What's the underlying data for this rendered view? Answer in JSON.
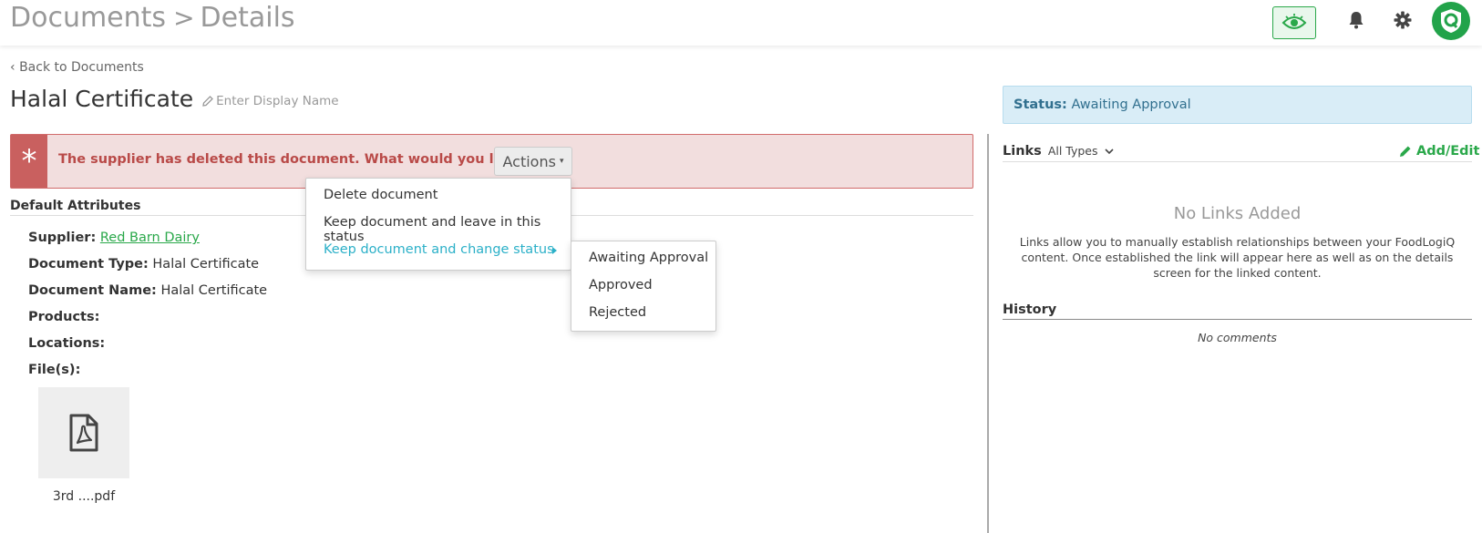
{
  "header": {
    "breadcrumb_root": "Documents",
    "breadcrumb_sep": ">",
    "breadcrumb_current": "Details",
    "icons": [
      "eye-icon",
      "bell-icon",
      "gear-icon",
      "foodlogiq-logo"
    ],
    "accent": "#2aa84a"
  },
  "back_link": "Back to Documents",
  "document": {
    "title": "Halal Certificate",
    "display_name_placeholder": "Enter Display Name"
  },
  "alert": {
    "symbol": "*",
    "message": "The supplier has deleted this document. What would you like to do?",
    "actions_label": "Actions"
  },
  "actions_menu": {
    "items": [
      {
        "label": "Delete document"
      },
      {
        "label": "Keep document and leave in this status"
      },
      {
        "label": "Keep document and change status"
      }
    ],
    "status_submenu": [
      {
        "label": "Awaiting Approval"
      },
      {
        "label": "Approved"
      },
      {
        "label": "Rejected"
      }
    ]
  },
  "attributes": {
    "section_title": "Default Attributes",
    "supplier_label": "Supplier:",
    "supplier_value": "Red Barn Dairy",
    "doc_type_label": "Document Type:",
    "doc_type_value": "Halal Certificate",
    "doc_name_label": "Document Name:",
    "doc_name_value": "Halal Certificate",
    "products_label": "Products:",
    "locations_label": "Locations:",
    "files_label": "File(s):",
    "file_name": "3rd ....pdf"
  },
  "status": {
    "label": "Status:",
    "value": "Awaiting Approval"
  },
  "links": {
    "title": "Links",
    "filter": "All Types",
    "add_edit": "Add/Edit",
    "empty_title": "No Links Added",
    "description": "Links allow you to manually establish relationships between your FoodLogiQ content. Once established the link will appear here as well as on the details screen for the linked content."
  },
  "history": {
    "title": "History",
    "empty": "No comments"
  }
}
